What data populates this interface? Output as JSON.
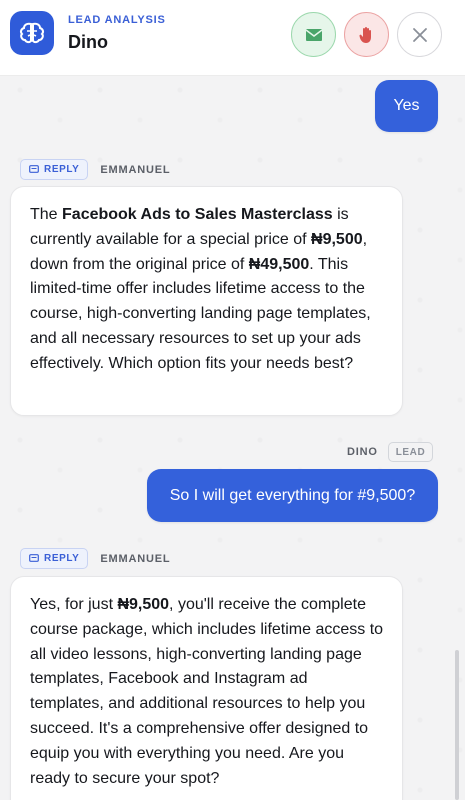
{
  "header": {
    "subtitle": "LEAD ANALYSIS",
    "title": "Dino",
    "icons": {
      "logo": "brain-icon",
      "mail": "envelope-icon",
      "stop": "raised-hand-icon",
      "close": "close-icon"
    },
    "colors": {
      "accent": "#3461db",
      "mail_bg": "#e6f6ea",
      "stop_bg": "#fbe6e6"
    }
  },
  "messages": [
    {
      "role": "lead",
      "text": "Yes"
    },
    {
      "role": "agent",
      "tag": "REPLY",
      "sender": "EMMANUEL",
      "parts": [
        {
          "t": "The ",
          "b": false
        },
        {
          "t": "Facebook Ads to Sales Masterclass",
          "b": true
        },
        {
          "t": " is currently available for a special price of ",
          "b": false
        },
        {
          "t": "₦9,500",
          "b": true
        },
        {
          "t": ", down from the original price of ",
          "b": false
        },
        {
          "t": "₦49,500",
          "b": true
        },
        {
          "t": ". This limited-time offer includes lifetime access to the course, high-converting landing page templates, and all necessary resources to set up your ads effectively. Which option fits your needs best?",
          "b": false
        }
      ]
    },
    {
      "role": "lead",
      "sender": "DINO",
      "tag": "LEAD",
      "text": "So I will get everything for #9,500?"
    },
    {
      "role": "agent",
      "tag": "REPLY",
      "sender": "EMMANUEL",
      "parts": [
        {
          "t": "Yes, for just ",
          "b": false
        },
        {
          "t": "₦9,500",
          "b": true
        },
        {
          "t": ", you'll receive the complete course package, which includes lifetime access to all video lessons, high-converting landing page templates, Facebook and Instagram ad templates, and additional resources to help you succeed. It's a comprehensive offer designed to equip you with everything you need. Are you ready to secure your spot?",
          "b": false
        }
      ]
    }
  ]
}
